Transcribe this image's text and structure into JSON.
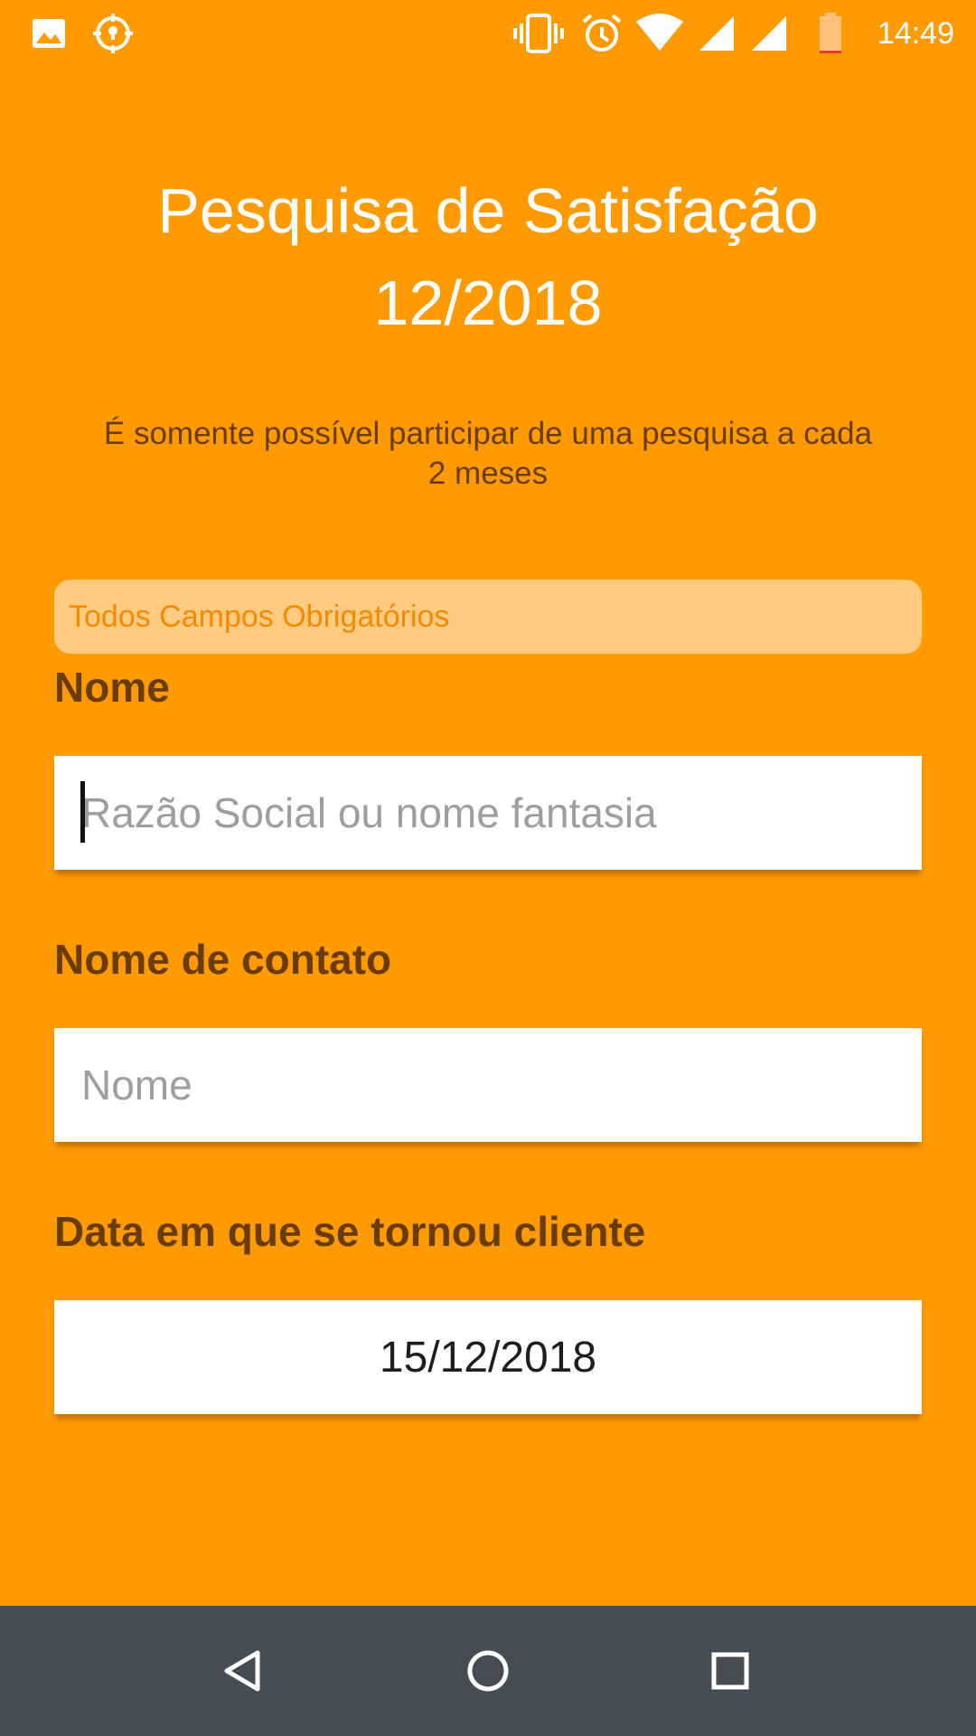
{
  "status_bar": {
    "time": "14:49",
    "left_icons": [
      "image-icon",
      "location-icon"
    ],
    "right_icons": [
      "vibrate-icon",
      "alarm-icon",
      "wifi-icon",
      "signal-icon",
      "signal-icon",
      "battery-icon"
    ]
  },
  "header": {
    "title_line1": "Pesquisa de Satisfação",
    "title_line2": "12/2018",
    "subtitle": "É somente possível participar de uma pesquisa a cada 2 meses"
  },
  "form": {
    "required_notice": "Todos Campos Obrigatórios",
    "fields": [
      {
        "label": "Nome",
        "placeholder": "Razão Social ou nome fantasia",
        "value": ""
      },
      {
        "label": "Nome de contato",
        "placeholder": "Nome",
        "value": ""
      },
      {
        "label": "Data em que se tornou cliente",
        "value": "15/12/2018"
      }
    ]
  },
  "navigation": {
    "buttons": [
      "back-icon",
      "home-icon",
      "recents-icon"
    ]
  },
  "colors": {
    "background": "#ff9a00",
    "label": "#6a3c05",
    "banner_bg": "#ffcb80",
    "banner_text": "#f38a00",
    "nav_bar": "#454c53"
  }
}
